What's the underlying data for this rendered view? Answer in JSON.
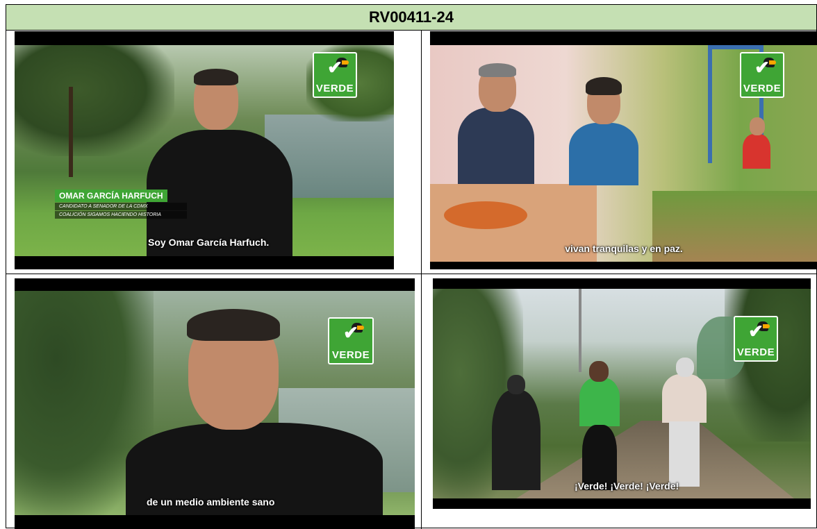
{
  "document": {
    "title": "RV00411-24"
  },
  "frames": [
    {
      "subtitle": "Soy Omar García Harfuch.",
      "logo_text": "VERDE",
      "lower_third": {
        "name": "OMAR GARCÍA HARFUCH",
        "line1": "CANDIDATO A SENADOR DE LA CDMX",
        "line2": "COALICIÓN SIGAMOS HACIENDO HISTORIA"
      }
    },
    {
      "subtitle": "vivan tranquilas y en paz.",
      "logo_text": "VERDE"
    },
    {
      "subtitle": "de un medio ambiente sano",
      "logo_text": "VERDE"
    },
    {
      "subtitle": "¡Verde! ¡Verde! ¡Verde!",
      "logo_text": "VERDE"
    }
  ],
  "colors": {
    "header_bg": "#c5e0b3",
    "logo_green": "#3fa535"
  }
}
